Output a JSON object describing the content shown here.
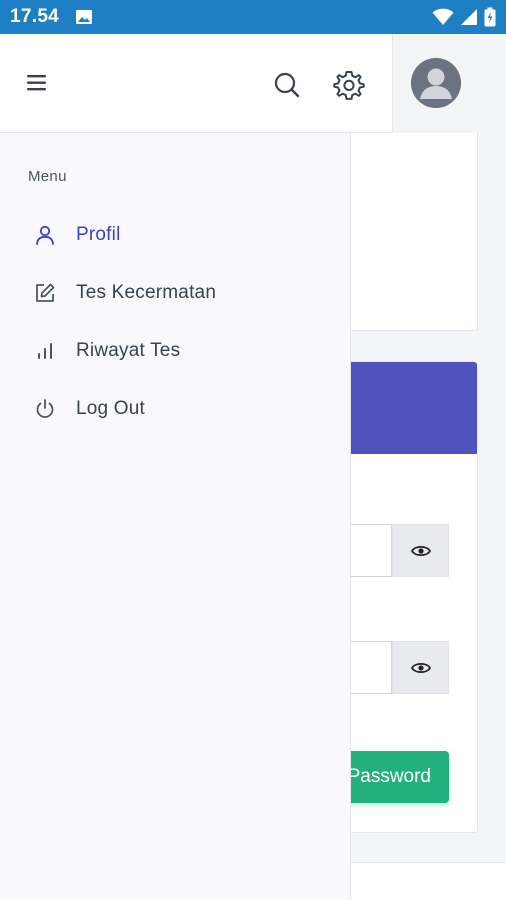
{
  "status_bar": {
    "time": "17.54",
    "icons": [
      "image-icon",
      "wifi-icon",
      "signal-icon",
      "battery-icon"
    ]
  },
  "top_bar": {
    "icons": [
      "menu-icon",
      "search-icon",
      "gear-icon",
      "avatar-icon"
    ]
  },
  "drawer": {
    "section_title": "Menu",
    "items": [
      {
        "label": "Profil",
        "icon": "user-icon",
        "active": true
      },
      {
        "label": "Tes Kecermatan",
        "icon": "edit-icon",
        "active": false
      },
      {
        "label": "Riwayat Tes",
        "icon": "bar-chart-icon",
        "active": false
      },
      {
        "label": "Log Out",
        "icon": "power-icon",
        "active": false
      }
    ]
  },
  "background": {
    "submit_label": "Password"
  },
  "colors": {
    "status_bar": "#1f7fc4",
    "accent": "#3f3fc1",
    "band": "#5053bd",
    "button": "#22b07d"
  }
}
